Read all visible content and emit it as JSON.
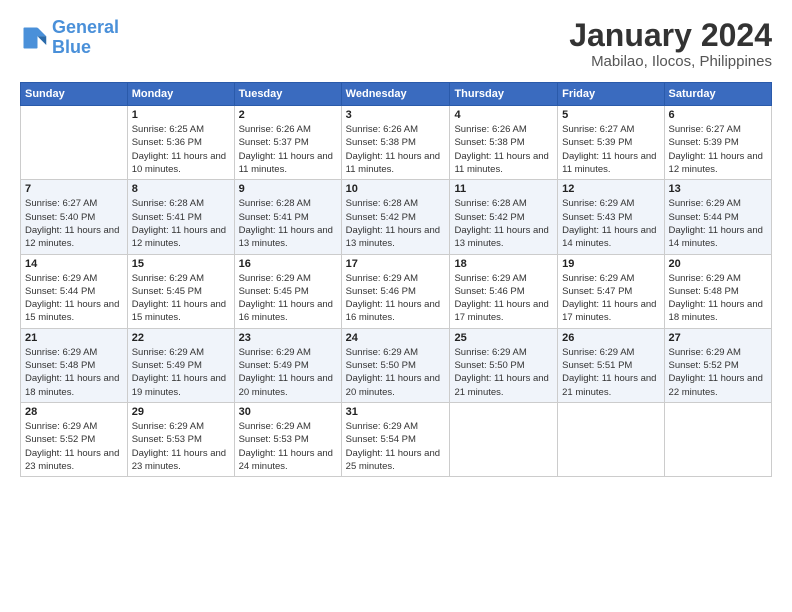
{
  "logo": {
    "line1": "General",
    "line2": "Blue"
  },
  "title": "January 2024",
  "subtitle": "Mabilao, Ilocos, Philippines",
  "weekdays": [
    "Sunday",
    "Monday",
    "Tuesday",
    "Wednesday",
    "Thursday",
    "Friday",
    "Saturday"
  ],
  "weeks": [
    [
      {
        "day": "",
        "sunrise": "",
        "sunset": "",
        "daylight": ""
      },
      {
        "day": "1",
        "sunrise": "Sunrise: 6:25 AM",
        "sunset": "Sunset: 5:36 PM",
        "daylight": "Daylight: 11 hours and 10 minutes."
      },
      {
        "day": "2",
        "sunrise": "Sunrise: 6:26 AM",
        "sunset": "Sunset: 5:37 PM",
        "daylight": "Daylight: 11 hours and 11 minutes."
      },
      {
        "day": "3",
        "sunrise": "Sunrise: 6:26 AM",
        "sunset": "Sunset: 5:38 PM",
        "daylight": "Daylight: 11 hours and 11 minutes."
      },
      {
        "day": "4",
        "sunrise": "Sunrise: 6:26 AM",
        "sunset": "Sunset: 5:38 PM",
        "daylight": "Daylight: 11 hours and 11 minutes."
      },
      {
        "day": "5",
        "sunrise": "Sunrise: 6:27 AM",
        "sunset": "Sunset: 5:39 PM",
        "daylight": "Daylight: 11 hours and 11 minutes."
      },
      {
        "day": "6",
        "sunrise": "Sunrise: 6:27 AM",
        "sunset": "Sunset: 5:39 PM",
        "daylight": "Daylight: 11 hours and 12 minutes."
      }
    ],
    [
      {
        "day": "7",
        "sunrise": "Sunrise: 6:27 AM",
        "sunset": "Sunset: 5:40 PM",
        "daylight": "Daylight: 11 hours and 12 minutes."
      },
      {
        "day": "8",
        "sunrise": "Sunrise: 6:28 AM",
        "sunset": "Sunset: 5:41 PM",
        "daylight": "Daylight: 11 hours and 12 minutes."
      },
      {
        "day": "9",
        "sunrise": "Sunrise: 6:28 AM",
        "sunset": "Sunset: 5:41 PM",
        "daylight": "Daylight: 11 hours and 13 minutes."
      },
      {
        "day": "10",
        "sunrise": "Sunrise: 6:28 AM",
        "sunset": "Sunset: 5:42 PM",
        "daylight": "Daylight: 11 hours and 13 minutes."
      },
      {
        "day": "11",
        "sunrise": "Sunrise: 6:28 AM",
        "sunset": "Sunset: 5:42 PM",
        "daylight": "Daylight: 11 hours and 13 minutes."
      },
      {
        "day": "12",
        "sunrise": "Sunrise: 6:29 AM",
        "sunset": "Sunset: 5:43 PM",
        "daylight": "Daylight: 11 hours and 14 minutes."
      },
      {
        "day": "13",
        "sunrise": "Sunrise: 6:29 AM",
        "sunset": "Sunset: 5:44 PM",
        "daylight": "Daylight: 11 hours and 14 minutes."
      }
    ],
    [
      {
        "day": "14",
        "sunrise": "Sunrise: 6:29 AM",
        "sunset": "Sunset: 5:44 PM",
        "daylight": "Daylight: 11 hours and 15 minutes."
      },
      {
        "day": "15",
        "sunrise": "Sunrise: 6:29 AM",
        "sunset": "Sunset: 5:45 PM",
        "daylight": "Daylight: 11 hours and 15 minutes."
      },
      {
        "day": "16",
        "sunrise": "Sunrise: 6:29 AM",
        "sunset": "Sunset: 5:45 PM",
        "daylight": "Daylight: 11 hours and 16 minutes."
      },
      {
        "day": "17",
        "sunrise": "Sunrise: 6:29 AM",
        "sunset": "Sunset: 5:46 PM",
        "daylight": "Daylight: 11 hours and 16 minutes."
      },
      {
        "day": "18",
        "sunrise": "Sunrise: 6:29 AM",
        "sunset": "Sunset: 5:46 PM",
        "daylight": "Daylight: 11 hours and 17 minutes."
      },
      {
        "day": "19",
        "sunrise": "Sunrise: 6:29 AM",
        "sunset": "Sunset: 5:47 PM",
        "daylight": "Daylight: 11 hours and 17 minutes."
      },
      {
        "day": "20",
        "sunrise": "Sunrise: 6:29 AM",
        "sunset": "Sunset: 5:48 PM",
        "daylight": "Daylight: 11 hours and 18 minutes."
      }
    ],
    [
      {
        "day": "21",
        "sunrise": "Sunrise: 6:29 AM",
        "sunset": "Sunset: 5:48 PM",
        "daylight": "Daylight: 11 hours and 18 minutes."
      },
      {
        "day": "22",
        "sunrise": "Sunrise: 6:29 AM",
        "sunset": "Sunset: 5:49 PM",
        "daylight": "Daylight: 11 hours and 19 minutes."
      },
      {
        "day": "23",
        "sunrise": "Sunrise: 6:29 AM",
        "sunset": "Sunset: 5:49 PM",
        "daylight": "Daylight: 11 hours and 20 minutes."
      },
      {
        "day": "24",
        "sunrise": "Sunrise: 6:29 AM",
        "sunset": "Sunset: 5:50 PM",
        "daylight": "Daylight: 11 hours and 20 minutes."
      },
      {
        "day": "25",
        "sunrise": "Sunrise: 6:29 AM",
        "sunset": "Sunset: 5:50 PM",
        "daylight": "Daylight: 11 hours and 21 minutes."
      },
      {
        "day": "26",
        "sunrise": "Sunrise: 6:29 AM",
        "sunset": "Sunset: 5:51 PM",
        "daylight": "Daylight: 11 hours and 21 minutes."
      },
      {
        "day": "27",
        "sunrise": "Sunrise: 6:29 AM",
        "sunset": "Sunset: 5:52 PM",
        "daylight": "Daylight: 11 hours and 22 minutes."
      }
    ],
    [
      {
        "day": "28",
        "sunrise": "Sunrise: 6:29 AM",
        "sunset": "Sunset: 5:52 PM",
        "daylight": "Daylight: 11 hours and 23 minutes."
      },
      {
        "day": "29",
        "sunrise": "Sunrise: 6:29 AM",
        "sunset": "Sunset: 5:53 PM",
        "daylight": "Daylight: 11 hours and 23 minutes."
      },
      {
        "day": "30",
        "sunrise": "Sunrise: 6:29 AM",
        "sunset": "Sunset: 5:53 PM",
        "daylight": "Daylight: 11 hours and 24 minutes."
      },
      {
        "day": "31",
        "sunrise": "Sunrise: 6:29 AM",
        "sunset": "Sunset: 5:54 PM",
        "daylight": "Daylight: 11 hours and 25 minutes."
      },
      {
        "day": "",
        "sunrise": "",
        "sunset": "",
        "daylight": ""
      },
      {
        "day": "",
        "sunrise": "",
        "sunset": "",
        "daylight": ""
      },
      {
        "day": "",
        "sunrise": "",
        "sunset": "",
        "daylight": ""
      }
    ]
  ]
}
